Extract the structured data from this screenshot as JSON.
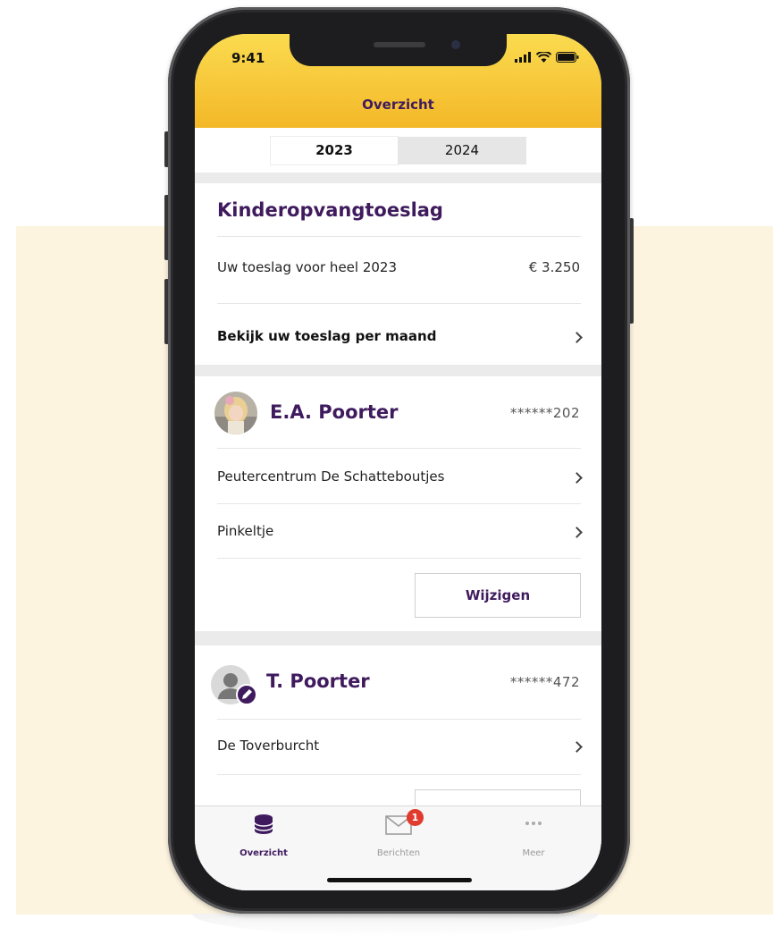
{
  "status_bar": {
    "time": "9:41"
  },
  "header": {
    "title": "Overzicht"
  },
  "year_tabs": [
    {
      "label": "2023",
      "selected": true
    },
    {
      "label": "2024",
      "selected": false
    }
  ],
  "allowance": {
    "title": "Kinderopvangtoeslag",
    "total_label": "Uw toeslag voor heel 2023",
    "total_amount": "€ 3.250",
    "per_month_link": "Bekijk uw toeslag per maand"
  },
  "children": [
    {
      "name": "E.A. Poorter",
      "bsn": "******202",
      "locations": [
        "Peutercentrum De Schatteboutjes",
        "Pinkeltje"
      ],
      "edit_label": "Wijzigen"
    },
    {
      "name": "T. Poorter",
      "bsn": "******472",
      "locations": [
        "De Toverburcht"
      ]
    }
  ],
  "tabbar": {
    "tabs": [
      {
        "label": "Overzicht",
        "active": true
      },
      {
        "label": "Berichten",
        "active": false,
        "badge": "1"
      },
      {
        "label": "Meer",
        "active": false
      }
    ]
  },
  "colors": {
    "brand_purple": "#3f1b5e",
    "header_yellow": "#f8cb3a",
    "badge_red": "#e03b2e",
    "backdrop_cream": "#fdf4e0"
  }
}
